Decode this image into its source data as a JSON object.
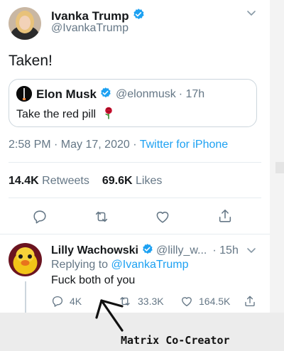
{
  "main_tweet": {
    "author_name": "Ivanka Trump",
    "author_handle": "@IvankaTrump",
    "text": "Taken!",
    "timestamp": "2:58 PM · May 17, 2020 · ",
    "source": "Twitter for iPhone",
    "retweets_count": "14.4K",
    "retweets_label": "Retweets",
    "likes_count": "69.6K",
    "likes_label": "Likes"
  },
  "quoted_tweet": {
    "author_name": "Elon Musk",
    "author_handle": "@elonmusk",
    "age": "· 17h",
    "text": "Take the red pill"
  },
  "reply": {
    "author_name": "Lilly Wachowski",
    "author_handle": "@lilly_w...",
    "age": "· 15h",
    "replying_prefix": "Replying to ",
    "replying_to": "@IvankaTrump",
    "text": "Fuck both of you",
    "reply_count": "4K",
    "retweet_count": "33.3K",
    "like_count": "164.5K"
  },
  "caption": "Matrix Co-Creator",
  "colors": {
    "accent": "#1da1f2",
    "text": "#14171a",
    "muted": "#657786",
    "border": "#ccd6dd"
  },
  "icons": [
    "verified-badge-icon",
    "chevron-down-icon",
    "reply-icon",
    "retweet-icon",
    "like-icon",
    "share-icon",
    "rose-emoji-icon"
  ]
}
